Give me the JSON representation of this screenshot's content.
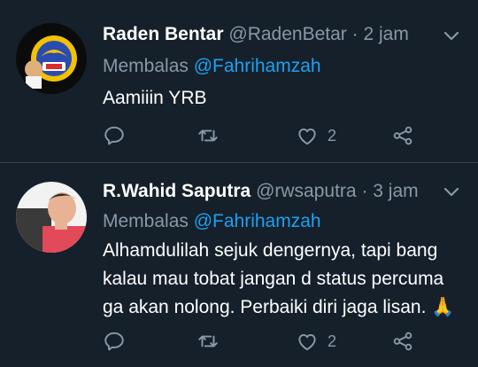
{
  "colors": {
    "background": "#15202b",
    "secondary_text": "#8899a6",
    "link": "#1da1f2",
    "divider": "#38444d"
  },
  "tweets": [
    {
      "name": "Raden Bentar",
      "handle": "@RadenBetar",
      "separator": "·",
      "time": "2 jam",
      "reply_prefix": "Membalas",
      "reply_to": "@Fahrihamzah",
      "text": "Aamiiin YRB",
      "like_count": "2",
      "icons": [
        "reply-icon",
        "retweet-icon",
        "like-icon",
        "share-icon",
        "chevron-down-icon"
      ]
    },
    {
      "name": "R.Wahid Saputra",
      "handle": "@rwsaputra",
      "separator": "·",
      "time": "3 jam",
      "reply_prefix": "Membalas",
      "reply_to": "@Fahrihamzah",
      "text": "Alhamdulilah sejuk dengernya, tapi bang kalau mau tobat jangan d status percuma ga akan nolong. Perbaiki diri jaga lisan. 🙏",
      "like_count": "2",
      "icons": [
        "reply-icon",
        "retweet-icon",
        "like-icon",
        "share-icon",
        "chevron-down-icon"
      ]
    }
  ]
}
